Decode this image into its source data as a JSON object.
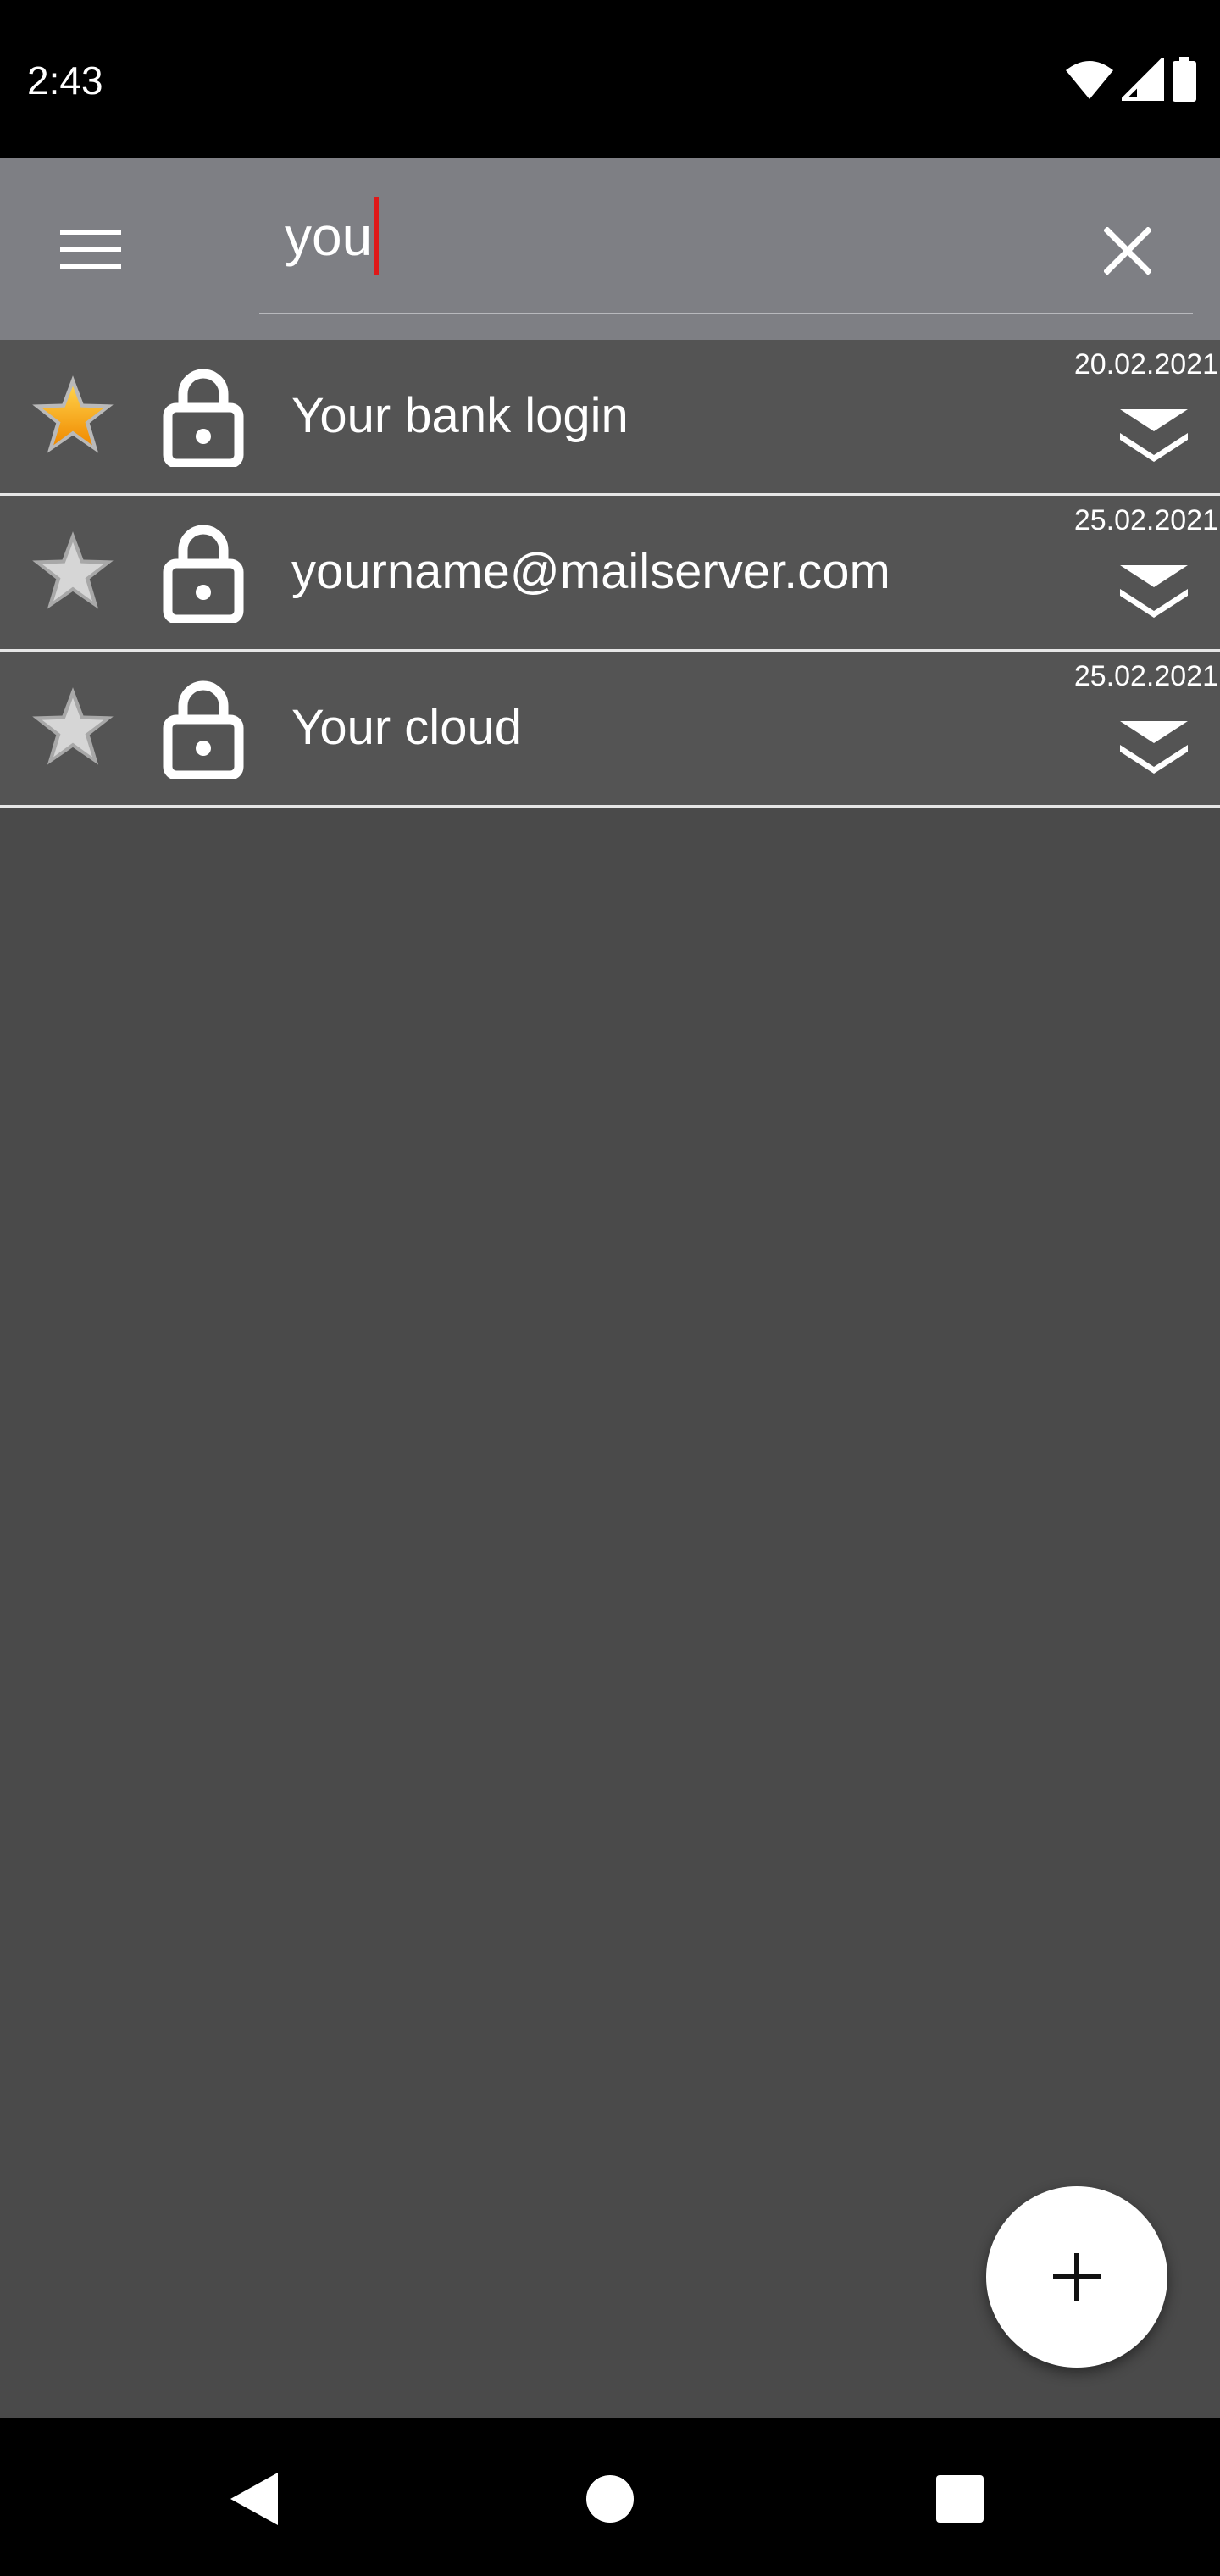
{
  "status_bar": {
    "time": "2:43",
    "icons": [
      "wifi-icon",
      "cell-signal-icon",
      "battery-icon"
    ]
  },
  "toolbar": {
    "menu_icon": "hamburger-menu-icon",
    "search_value": "you",
    "clear_icon": "close-icon"
  },
  "entries": [
    {
      "title": "Your bank login",
      "date": "20.02.2021",
      "favorite": true
    },
    {
      "title": "yourname@mailserver.com",
      "date": "25.02.2021",
      "favorite": false
    },
    {
      "title": "Your cloud",
      "date": "25.02.2021",
      "favorite": false
    }
  ],
  "fab": {
    "icon": "plus-icon"
  },
  "nav_bar": {
    "icons": [
      "back-icon",
      "home-icon",
      "recents-icon"
    ]
  },
  "colors": {
    "toolbar": "#7e7f84",
    "list_background": "#4a4a4a",
    "row_background": "#545454",
    "caret": "#e01818",
    "favorite_star": "#f5a623"
  }
}
